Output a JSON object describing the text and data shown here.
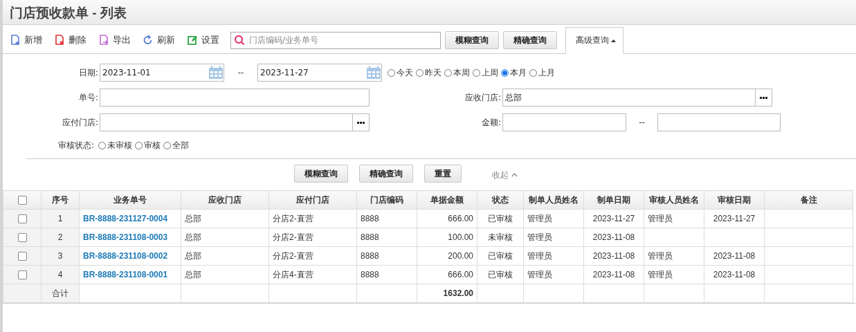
{
  "title": "门店预收款单 - 列表",
  "toolbar": {
    "actions": [
      {
        "label": "新增",
        "kind": "add"
      },
      {
        "label": "删除",
        "kind": "delete"
      },
      {
        "label": "导出",
        "kind": "export"
      },
      {
        "label": "刷新",
        "kind": "refresh"
      },
      {
        "label": "设置",
        "kind": "settings"
      }
    ],
    "search": {
      "placeholder": "门店编码/业务单号"
    },
    "buttons": [
      "模糊查询",
      "精确查询"
    ],
    "advanced": {
      "label": "高级查询",
      "expanded": true
    }
  },
  "filters": {
    "date": {
      "label": "日期:",
      "from": "2023-11-01",
      "separator": "--",
      "to": "2023-11-27"
    },
    "date_ranges": [
      {
        "label": "今天",
        "selected": false
      },
      {
        "label": "昨天",
        "selected": false
      },
      {
        "label": "本周",
        "selected": false
      },
      {
        "label": "上周",
        "selected": false
      },
      {
        "label": "本月",
        "selected": true
      },
      {
        "label": "上月",
        "selected": false
      }
    ],
    "order_no": {
      "label": "单号:"
    },
    "receiving_store": {
      "label": "应收门店:",
      "value": "总部"
    },
    "paying_store": {
      "label": "应付门店:"
    },
    "amount": {
      "label": "金额:",
      "separator": "--"
    },
    "audit_status": {
      "label": "审核状态:",
      "options": [
        {
          "label": "未审核",
          "selected": false
        },
        {
          "label": "审核",
          "selected": false
        },
        {
          "label": "全部",
          "selected": false
        }
      ]
    },
    "buttons": [
      "模糊查询",
      "精确查询",
      "重置"
    ],
    "collapse": {
      "label": "收起"
    }
  },
  "table": {
    "select_all": {
      "checked": false
    },
    "columns": [
      "序号",
      "业务单号",
      "应收门店",
      "应付门店",
      "门店编码",
      "单据金额",
      "状态",
      "制单人员姓名",
      "制单日期",
      "审核人员姓名",
      "审核日期",
      "备注"
    ],
    "rows": [
      {
        "checked": false,
        "cells": [
          "1",
          "BR-8888-231127-0004",
          "总部",
          "分店2-直营",
          "8888",
          "666.00",
          "已审核",
          "管理员",
          "2023-11-27",
          "管理员",
          "2023-11-27",
          ""
        ]
      },
      {
        "checked": false,
        "cells": [
          "2",
          "BR-8888-231108-0003",
          "总部",
          "分店2-直营",
          "8888",
          "100.00",
          "未审核",
          "管理员",
          "2023-11-08",
          "",
          "",
          ""
        ]
      },
      {
        "checked": false,
        "cells": [
          "3",
          "BR-8888-231108-0002",
          "总部",
          "分店2-直营",
          "8888",
          "200.00",
          "已审核",
          "管理员",
          "2023-11-08",
          "管理员",
          "2023-11-08",
          ""
        ]
      },
      {
        "checked": false,
        "cells": [
          "4",
          "BR-8888-231108-0001",
          "总部",
          "分店4-直营",
          "8888",
          "666.00",
          "已审核",
          "管理员",
          "2023-11-08",
          "管理员",
          "2023-11-08",
          ""
        ]
      }
    ],
    "footer": {
      "label": "合计",
      "total": "1632.00"
    }
  }
}
